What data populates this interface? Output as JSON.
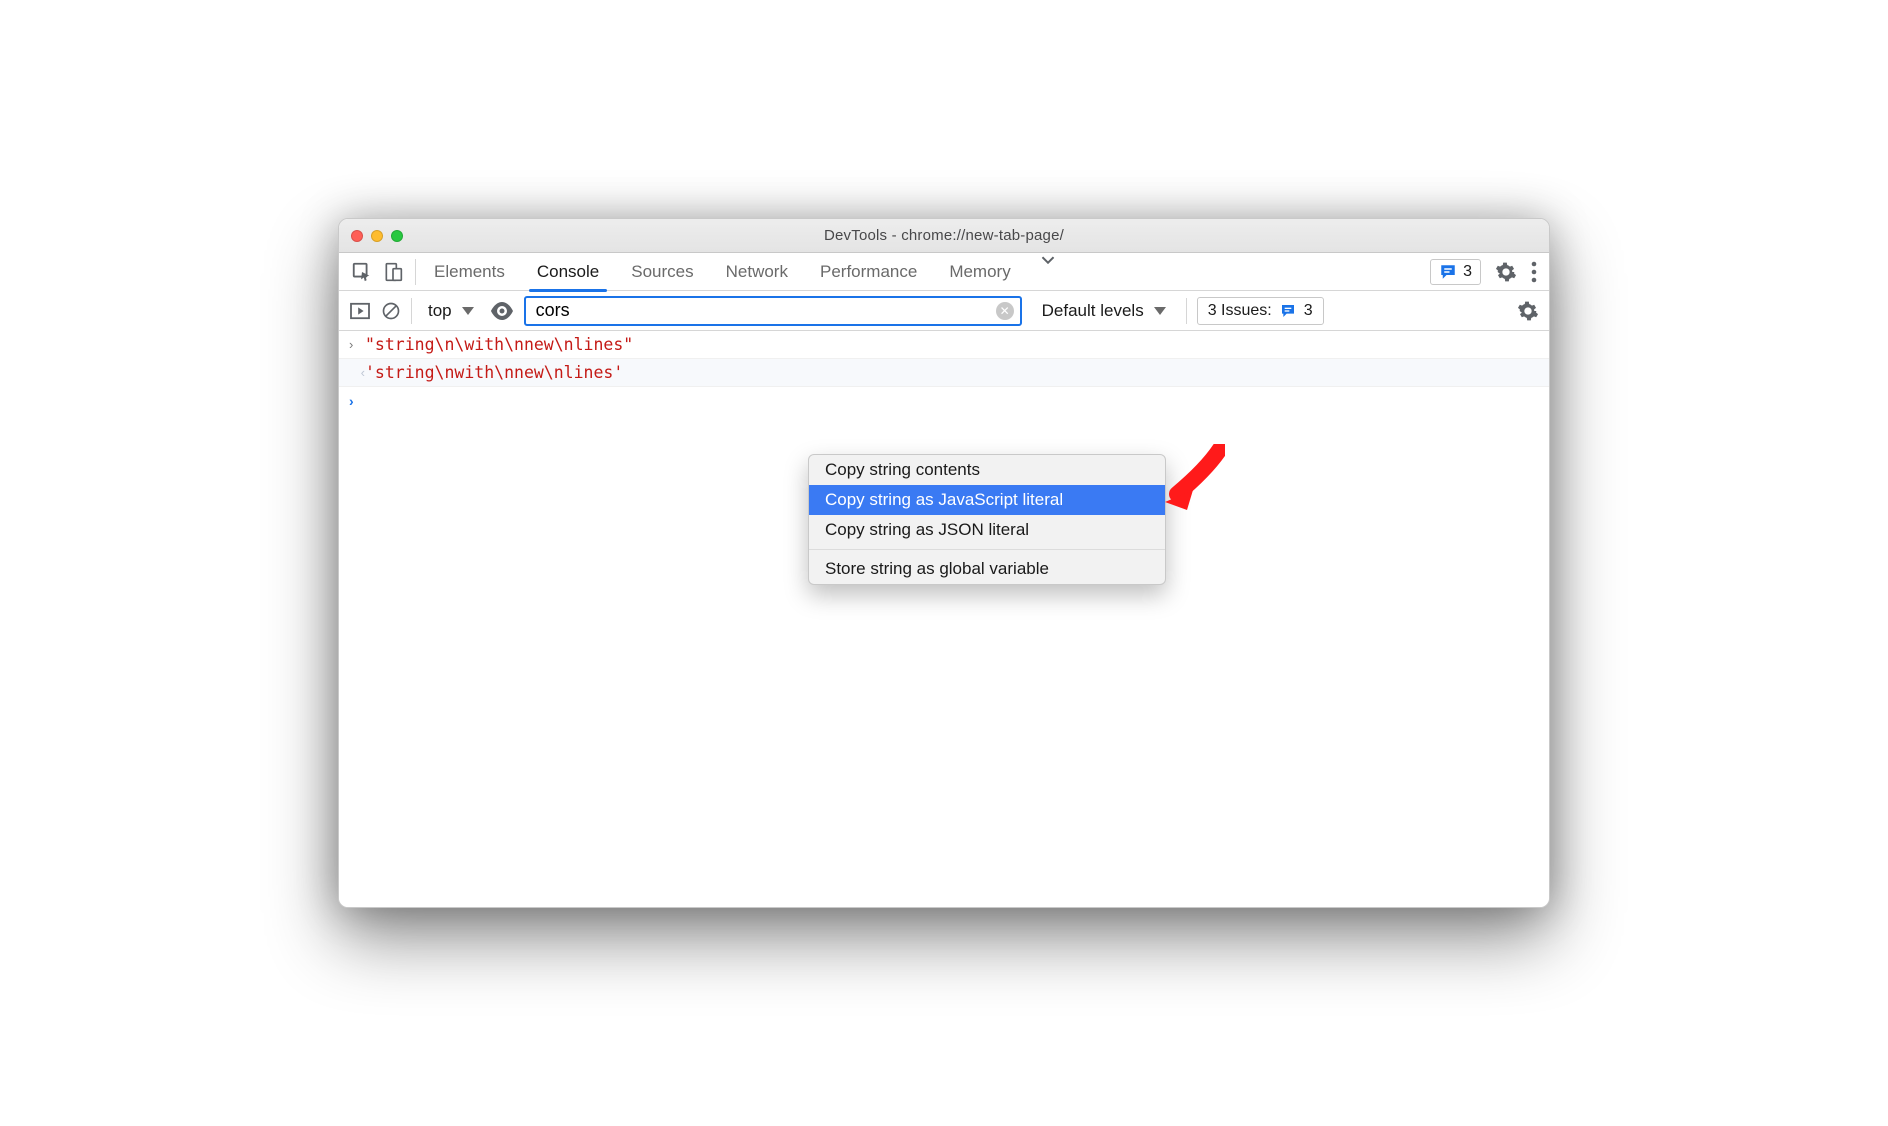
{
  "window": {
    "title": "DevTools - chrome://new-tab-page/"
  },
  "tabs": {
    "items": [
      "Elements",
      "Console",
      "Sources",
      "Network",
      "Performance",
      "Memory"
    ],
    "active": "Console"
  },
  "header_badge": {
    "count": "3"
  },
  "toolbar": {
    "context": "top",
    "filter_value": "cors",
    "levels_label": "Default levels",
    "issues_label": "3 Issues:",
    "issues_count": "3"
  },
  "console": {
    "lines": [
      {
        "kind": "input",
        "text": "\"string\\n\\with\\nnew\\nlines\""
      },
      {
        "kind": "output",
        "text": "'string\\nwith\\nnew\\nlines'"
      }
    ]
  },
  "context_menu": {
    "items": [
      {
        "label": "Copy string contents",
        "hover": false
      },
      {
        "label": "Copy string as JavaScript literal",
        "hover": true
      },
      {
        "label": "Copy string as JSON literal",
        "hover": false
      }
    ],
    "second_group": [
      {
        "label": "Store string as global variable",
        "hover": false
      }
    ]
  }
}
